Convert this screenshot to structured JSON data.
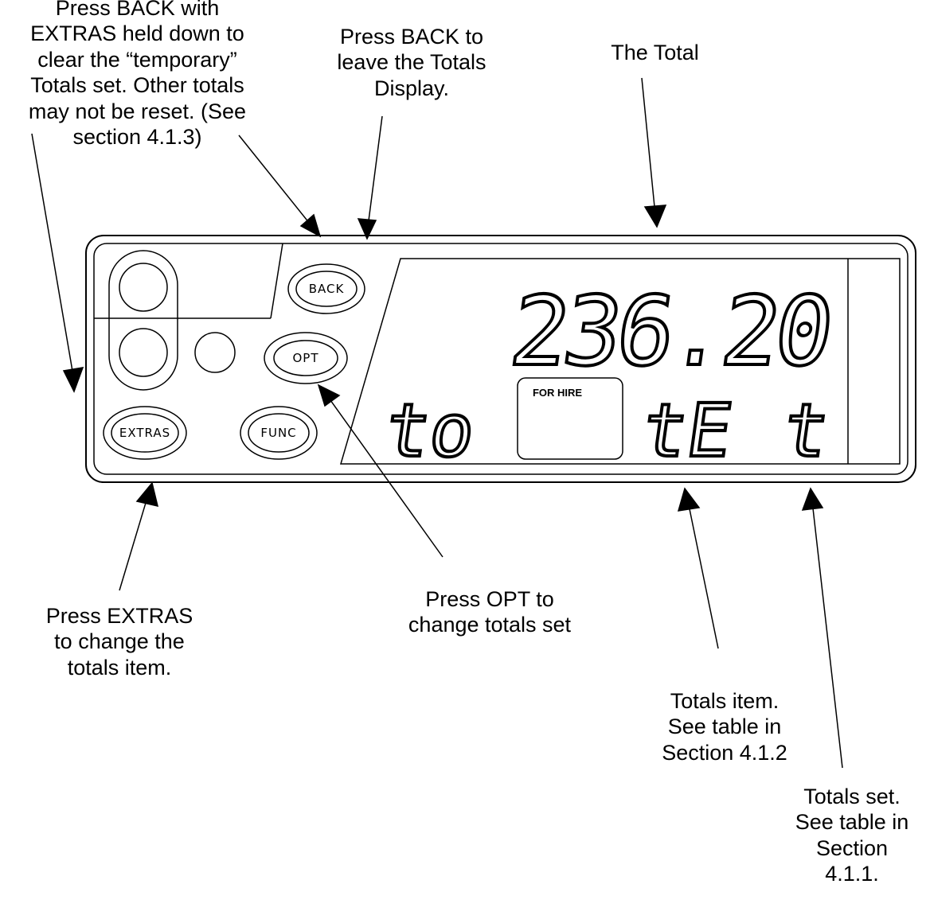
{
  "callouts": {
    "back_extras": "Press BACK with\nEXTRAS held down  to\nclear the “temporary”\nTotals set. Other totals\nmay not be reset. (See\nsection 4.1.3)",
    "back": "Press BACK to\nleave the Totals\nDisplay.",
    "total": "The Total",
    "extras": "Press EXTRAS\nto change the\ntotals item.",
    "opt": "Press OPT to\nchange totals set",
    "totals_item": "Totals item.\nSee table in\nSection 4.1.2",
    "totals_set": "Totals set.\nSee table in\nSection\n4.1.1."
  },
  "buttons": {
    "back": "BACK",
    "opt": "OPT",
    "extras": "EXTRAS",
    "func": "FUNC"
  },
  "display": {
    "total_value": "236.20",
    "lower_left": "to",
    "lower_mid": "tE",
    "lower_right": "t",
    "for_hire": "FOR HIRE"
  }
}
